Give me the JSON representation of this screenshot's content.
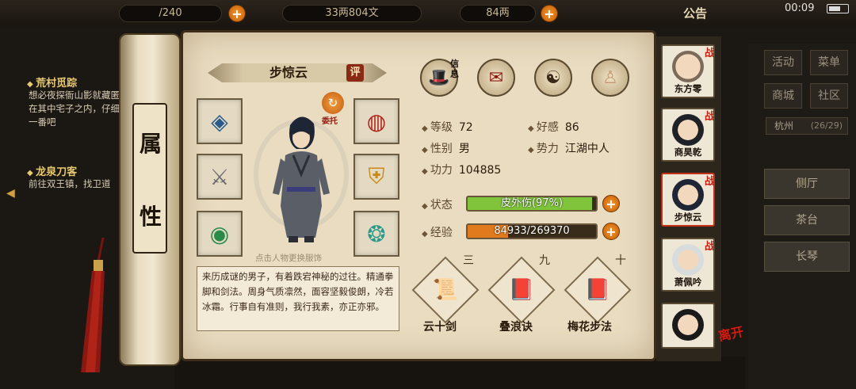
{
  "hud": {
    "capacity": "/240",
    "silver": "33两804文",
    "gold": "84两",
    "notice": "公告",
    "clock": "00:09"
  },
  "quests": [
    {
      "title": "荒村觅踪",
      "desc": "想必夜探衙山影就藏匿在其中宅子之内，仔细一番吧"
    },
    {
      "title": "龙泉刀客",
      "desc": "前往双王镇，找卫道"
    }
  ],
  "side_menu": {
    "buttons": [
      "活动",
      "菜单",
      "商城",
      "社区"
    ],
    "city": "杭州",
    "city_count": "(26/29)",
    "locations": [
      "侧厅",
      "茶台",
      "长琴"
    ]
  },
  "scroll": {
    "title_glyphs": [
      "属",
      "性"
    ]
  },
  "character": {
    "name": "步惊云",
    "review_label": "评",
    "entrust_label": "委托",
    "portrait_hint": "点击人物更换服饰",
    "bio": "来历成谜的男子，有着跌宕神秘的过往。精通拳脚和剑法。周身气质凛然，面容坚毅俊朗，冷若冰霜。行事自有准则，我行我素，亦正亦邪。"
  },
  "tabs": {
    "info_label": "信息"
  },
  "stats": {
    "level_label": "等级",
    "level": "72",
    "favor_label": "好感",
    "favor": "86",
    "gender_label": "性别",
    "gender": "男",
    "faction_label": "势力",
    "faction": "江湖中人",
    "power_label": "功力",
    "power": "104885"
  },
  "status": {
    "label": "状态",
    "text": "皮外伤(97%)",
    "percent": 97,
    "color": "#7fc43a"
  },
  "experience": {
    "label": "经验",
    "text": "84933/269370",
    "current": 84933,
    "max": 269370,
    "color": "#e07a1c"
  },
  "skills": [
    {
      "rank": "三",
      "name": "云十剑",
      "icon": "scroll-icon"
    },
    {
      "rank": "九",
      "name": "叠浪诀",
      "icon": "book-icon"
    },
    {
      "rank": "十",
      "name": "梅花步法",
      "icon": "book-icon"
    }
  ],
  "party": [
    {
      "name": "东方零",
      "battle": "战"
    },
    {
      "name": "商昊乾",
      "battle": "战"
    },
    {
      "name": "步惊云",
      "battle": "战"
    },
    {
      "name": "萧佩吟",
      "battle": "战"
    },
    {
      "name": "",
      "battle": ""
    }
  ],
  "leave_label": "离开"
}
